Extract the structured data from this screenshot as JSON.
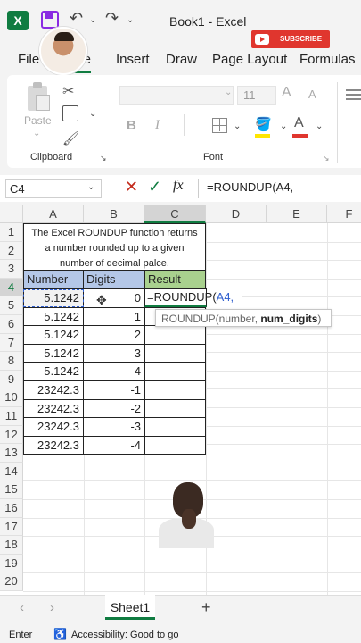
{
  "window": {
    "title": "Book1 - Excel"
  },
  "overlay": {
    "subscribe_label": "SUBSCRIBE"
  },
  "tabs": [
    {
      "label": "File"
    },
    {
      "label": "Home"
    },
    {
      "label": "Insert"
    },
    {
      "label": "Draw"
    },
    {
      "label": "Page Layout"
    },
    {
      "label": "Formulas"
    }
  ],
  "ribbon": {
    "paste_label": "Paste",
    "clipboard_label": "Clipboard",
    "font_label": "Font",
    "font_size": "11",
    "bold": "B",
    "italic": "I",
    "grow_font": "A",
    "shrink_font": "A"
  },
  "formula_bar": {
    "name_box": "C4",
    "formula": "=ROUNDUP(A4,"
  },
  "columns": [
    "A",
    "B",
    "C",
    "D",
    "E",
    "F"
  ],
  "rows": [
    "1",
    "2",
    "3",
    "4",
    "5",
    "6",
    "7",
    "8",
    "9",
    "10",
    "11",
    "12",
    "13",
    "14",
    "15",
    "16",
    "17",
    "18",
    "19",
    "20"
  ],
  "sheet": {
    "description": "The Excel ROUNDUP function returns a number rounded up to a given number of decimal palce.",
    "headers": {
      "number": "Number",
      "digits": "Digits",
      "result": "Result"
    },
    "data": [
      {
        "number": "5.1242",
        "digits": "0"
      },
      {
        "number": "5.1242",
        "digits": "1"
      },
      {
        "number": "5.1242",
        "digits": "2"
      },
      {
        "number": "5.1242",
        "digits": "3"
      },
      {
        "number": "5.1242",
        "digits": "4"
      },
      {
        "number": "23242.3",
        "digits": "-1"
      },
      {
        "number": "23242.3",
        "digits": "-2"
      },
      {
        "number": "23242.3",
        "digits": "-3"
      },
      {
        "number": "23242.3",
        "digits": "-4"
      }
    ],
    "edit_cell": {
      "prefix": "=ROUNDUP(",
      "ref": "A4,",
      "cursor": ""
    },
    "tooltip": {
      "prefix": "ROUNDUP(number, ",
      "bold_part": "num_digits",
      "suffix": ")"
    }
  },
  "sheet_tabs": [
    {
      "label": "Sheet1"
    }
  ],
  "status": {
    "mode": "Enter",
    "accessibility": "Accessibility: Good to go"
  },
  "colors": {
    "excel_green": "#107c41",
    "header_fill": "#b4c7e7",
    "result_fill": "#a9d18e"
  }
}
